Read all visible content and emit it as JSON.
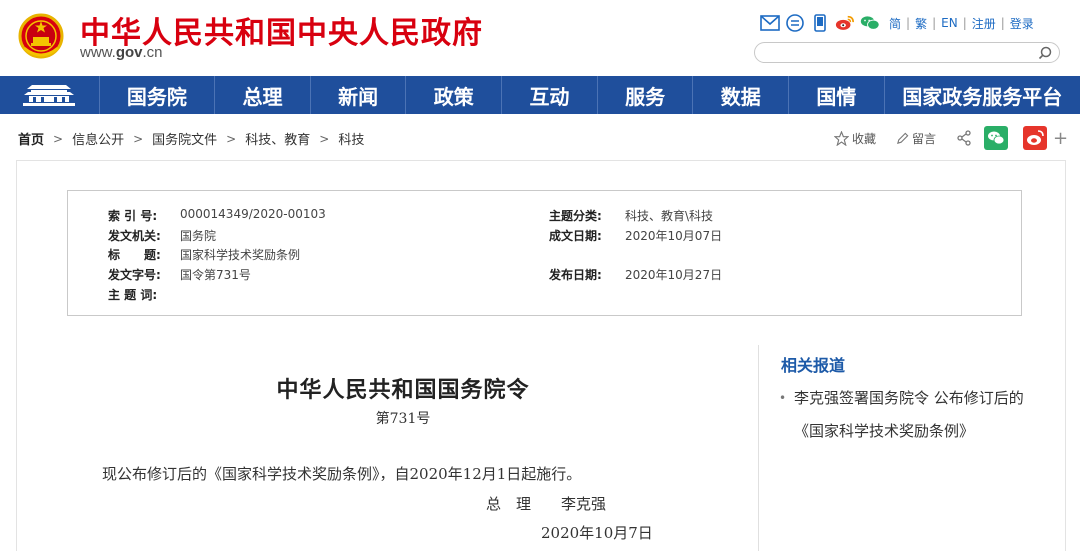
{
  "header": {
    "site_title": "中华人民共和国中央人民政府",
    "domain_prefix": "www.",
    "domain_main": "gov",
    "domain_suffix": ".cn",
    "lang_links": [
      "简",
      "繁",
      "EN",
      "注册",
      "登录"
    ],
    "tool_icons": [
      "mail-icon",
      "chat-bubble-icon",
      "mobile-icon",
      "weibo-icon",
      "wechat-icon"
    ],
    "search_placeholder": ""
  },
  "nav": {
    "items": [
      "国务院",
      "总理",
      "新闻",
      "政策",
      "互动",
      "服务",
      "数据",
      "国情",
      "国家政务服务平台"
    ]
  },
  "breadcrumb": {
    "items": [
      "首页",
      "信息公开",
      "国务院文件",
      "科技、教育",
      "科技"
    ]
  },
  "share": {
    "favorite": "收藏",
    "comment": "留言"
  },
  "meta": {
    "index_label": "索 引 号:",
    "index_value": "000014349/2020-00103",
    "issuer_label": "发文机关:",
    "issuer_value": "国务院",
    "title_label": "标　　题:",
    "title_value": "国家科学技术奖励条例",
    "docno_label": "发文字号:",
    "docno_value": "国令第731号",
    "keywords_label": "主 题 词:",
    "keywords_value": "",
    "category_label": "主题分类:",
    "category_value": "科技、教育\\科技",
    "written_label": "成文日期:",
    "written_value": "2020年10月07日",
    "published_label": "发布日期:",
    "published_value": "2020年10月27日"
  },
  "document": {
    "title": "中华人民共和国国务院令",
    "number": "第731号",
    "body": "现公布修订后的《国家科学技术奖励条例》，自2020年12月1日起施行。",
    "signer": "总　理　　李克强",
    "date": "2020年10月7日"
  },
  "related": {
    "heading": "相关报道",
    "items": [
      "李克强签署国务院令 公布修订后的《国家科学技术奖励条例》"
    ]
  },
  "colors": {
    "brand_red": "#d8000f",
    "nav_blue": "#1f4f9c",
    "link_blue": "#1d6bc3",
    "wechat_green": "#2aae67",
    "weibo_red": "#e6352b"
  }
}
